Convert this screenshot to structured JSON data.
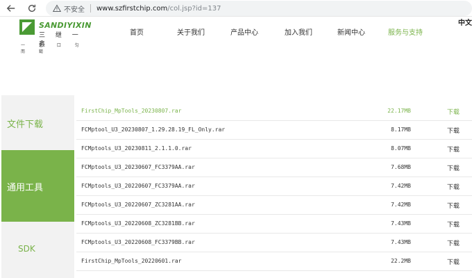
{
  "browser": {
    "insecure_label": "不安全",
    "url_host": "www.szfirstchip.com",
    "url_path": "/col.jsp?id=137"
  },
  "colors": {
    "brand_green": "#7ab34a",
    "logo_green": "#4a9a34"
  },
  "logo": {
    "brand_en": "SANDIYIXIN",
    "brand_cn": "三 继 一 鑫",
    "slogan": "一 艺 口 匀 而 鎚"
  },
  "nav": {
    "items": [
      {
        "label": "首页"
      },
      {
        "label": "关于我们"
      },
      {
        "label": "产品中心"
      },
      {
        "label": "加入我们"
      },
      {
        "label": "新闻中心"
      },
      {
        "label": "服务与支持"
      }
    ],
    "lang": "中文"
  },
  "sidebar": {
    "items": [
      {
        "label": "文件下载"
      },
      {
        "label": "通用工具"
      },
      {
        "label": "SDK"
      }
    ]
  },
  "files": [
    {
      "name": "FirstChip_MpTools_20230807.rar",
      "size": "22.17MB",
      "download": "下载"
    },
    {
      "name": "FCMptool_U3_20230807_1.29.28.19_FL_Only.rar",
      "size": "8.17MB",
      "download": "下载"
    },
    {
      "name": "FCMptools_U3_20230811_2.1.1.0.rar",
      "size": "8.07MB",
      "download": "下载"
    },
    {
      "name": "FCMptools_U3_20230607_FC3379AA.rar",
      "size": "7.68MB",
      "download": "下载"
    },
    {
      "name": "FCMptools_U3_20220607_FC3379AA.rar",
      "size": "7.42MB",
      "download": "下载"
    },
    {
      "name": "FCMptools_U3_20220607_ZC3281AA.rar",
      "size": "7.42MB",
      "download": "下载"
    },
    {
      "name": "FCMptools_U3_20220608_ZC3281BB.rar",
      "size": "7.43MB",
      "download": "下载"
    },
    {
      "name": "FCMptools_U3_20220608_FC3379BB.rar",
      "size": "7.43MB",
      "download": "下载"
    },
    {
      "name": "FirstChip_MpTools_20220601.rar",
      "size": "22.2MB",
      "download": "下载"
    }
  ]
}
